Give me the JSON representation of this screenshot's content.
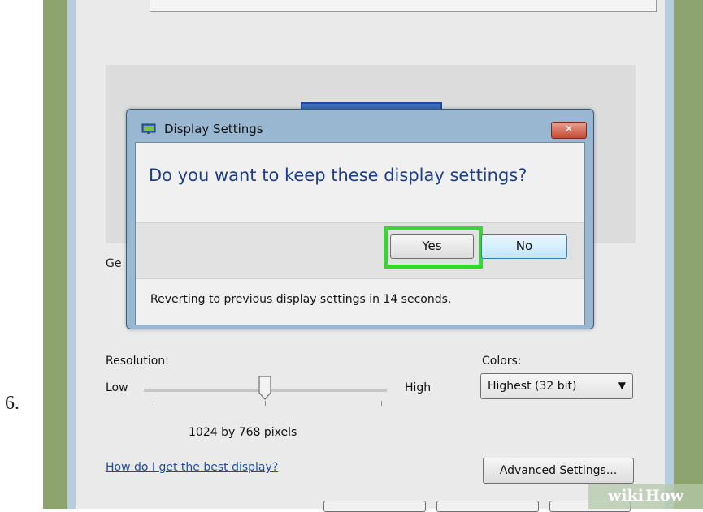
{
  "step_number": "6.",
  "background_label": "Ge",
  "dialog": {
    "title": "Display Settings",
    "close_symbol": "✕",
    "question": "Do you want to keep these display settings?",
    "yes_label": "Yes",
    "no_label": "No",
    "status_text": "Reverting to previous display settings in 14 seconds."
  },
  "resolution": {
    "label": "Resolution:",
    "low_label": "Low",
    "high_label": "High",
    "value_text": "1024 by 768 pixels"
  },
  "colors": {
    "label": "Colors:",
    "selected": "Highest (32 bit)"
  },
  "help_link": "How do I get the best display?",
  "advanced_button": "Advanced Settings...",
  "watermark": {
    "wiki": "wiki",
    "how": "How"
  },
  "icons": [
    "display-settings-icon",
    "close-icon",
    "chevron-down-icon",
    "slider-thumb-icon"
  ],
  "colors_theme": {
    "highlight": "#3fd13a",
    "question_text": "#1c3d8c",
    "link": "#1a4fa8"
  }
}
